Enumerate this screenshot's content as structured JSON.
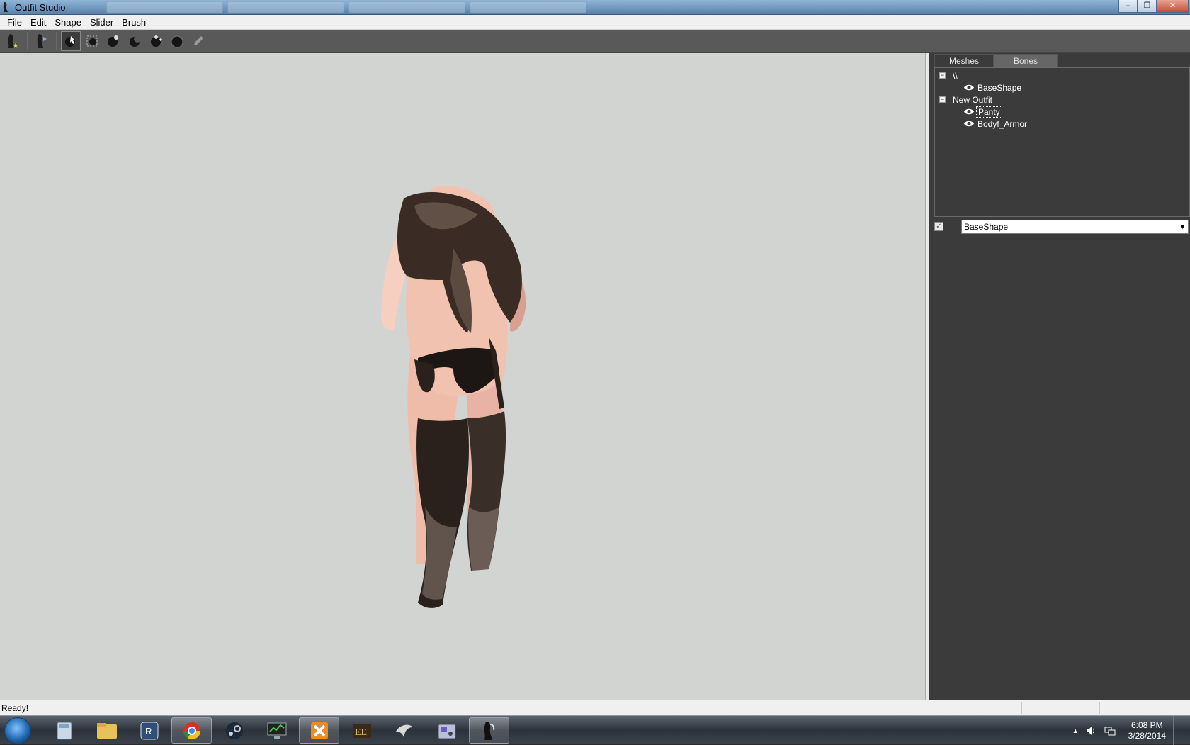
{
  "window": {
    "title": "Outfit Studio",
    "controls": {
      "minimize": "‒",
      "maximize": "❐",
      "close": "✕"
    }
  },
  "menubar": {
    "items": [
      "File",
      "Edit",
      "Shape",
      "Slider",
      "Brush"
    ]
  },
  "toolbar": {
    "buttons": [
      {
        "name": "new-project-button",
        "icon": "figure-new-icon"
      },
      {
        "name": "load-reference-button",
        "icon": "figure-load-icon"
      },
      {
        "name": "select-brush-button",
        "icon": "arrow-cursor-icon",
        "active": true
      },
      {
        "name": "mask-brush-button",
        "icon": "mask-icon"
      },
      {
        "name": "inflate-brush-button",
        "icon": "inflate-icon"
      },
      {
        "name": "deflate-brush-button",
        "icon": "deflate-icon"
      },
      {
        "name": "move-brush-button",
        "icon": "move-icon"
      },
      {
        "name": "smooth-brush-button",
        "icon": "smooth-icon"
      },
      {
        "name": "weight-brush-button",
        "icon": "pencil-icon"
      }
    ]
  },
  "right_panel": {
    "tabs": {
      "meshes": "Meshes",
      "bones": "Bones"
    },
    "active_tab": "Meshes",
    "tree": {
      "groups": [
        {
          "label": "\\\\",
          "expanded": true,
          "children": [
            {
              "label": "BaseShape"
            }
          ]
        },
        {
          "label": "New Outfit",
          "expanded": true,
          "children": [
            {
              "label": "Panty",
              "selected": true
            },
            {
              "label": "Bodyf_Armor"
            }
          ]
        }
      ]
    },
    "slider": {
      "checked": true,
      "selected_shape": "BaseShape"
    }
  },
  "statusbar": {
    "text": "Ready!"
  },
  "taskbar": {
    "apps": [
      "calculator-icon",
      "explorer-icon",
      "app-icon",
      "chrome-icon",
      "steam-icon",
      "monitor-icon",
      "xsplit-icon",
      "game-icon",
      "skyrim-icon",
      "tool-icon",
      "outfit-studio-icon"
    ],
    "clock": {
      "time": "6:08 PM",
      "date": "3/28/2014"
    }
  },
  "colors": {
    "viewport_bg": "#d2d4d2",
    "panel_bg": "#3b3b3b",
    "toolbar_bg": "#595959"
  }
}
